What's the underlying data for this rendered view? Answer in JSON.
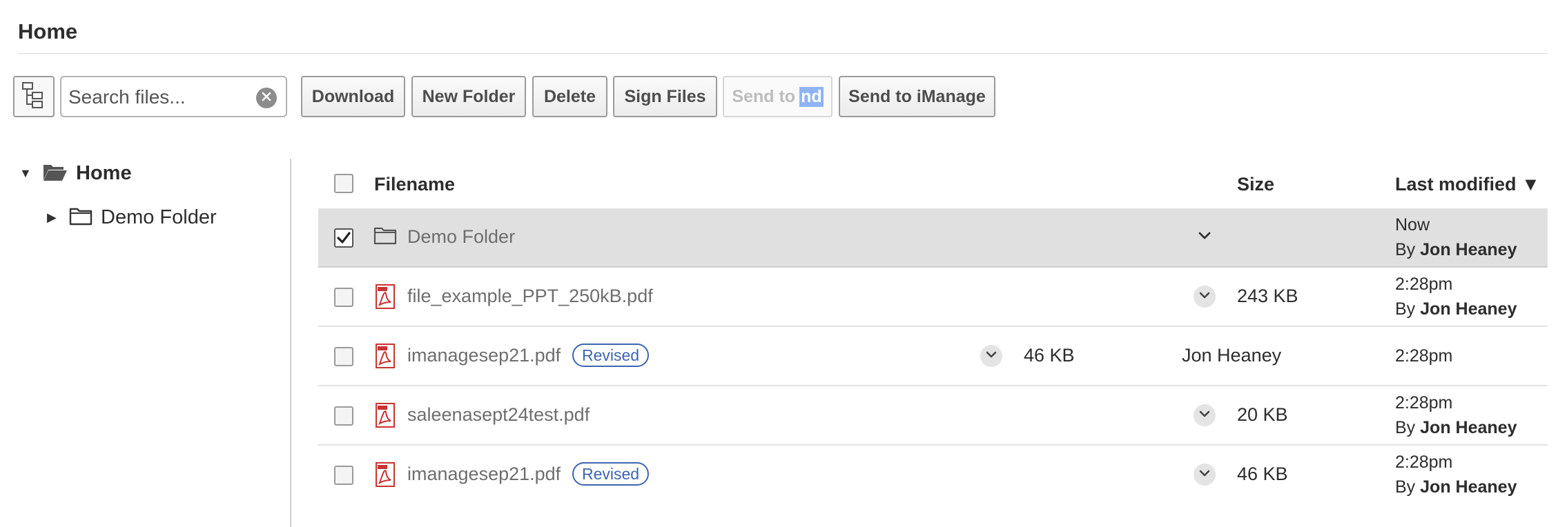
{
  "page": {
    "title": "Home"
  },
  "toolbar": {
    "search_placeholder": "Search files...",
    "download": "Download",
    "new_folder": "New Folder",
    "delete": "Delete",
    "sign_files": "Sign Files",
    "send_to": "Send to",
    "send_to_highlight": "nd",
    "send_to_imanage": "Send to iManage"
  },
  "tree": {
    "root": "Home",
    "children": [
      {
        "label": "Demo Folder"
      }
    ]
  },
  "table": {
    "headers": {
      "filename": "Filename",
      "size": "Size",
      "last_modified": "Last modified ▼"
    },
    "rows": [
      {
        "name": "Demo Folder",
        "type": "folder",
        "selected": true,
        "size": "",
        "modified": "Now",
        "by": "By",
        "author": "Jon Heaney"
      },
      {
        "name": "file_example_PPT_250kB.pdf",
        "type": "pdf",
        "selected": false,
        "size": "243 KB",
        "modified": "2:28pm",
        "by": "By",
        "author": "Jon Heaney"
      },
      {
        "name": "imanagesep21.pdf",
        "type": "pdf",
        "selected": false,
        "badge": "Revised",
        "size": "46 KB",
        "owner": "Jon Heaney",
        "modified": "2:28pm"
      },
      {
        "name": "saleenasept24test.pdf",
        "type": "pdf",
        "selected": false,
        "size": "20 KB",
        "modified": "2:28pm",
        "by": "By",
        "author": "Jon Heaney"
      },
      {
        "name": "imanagesep21.pdf",
        "type": "pdf",
        "selected": false,
        "badge": "Revised",
        "size": "46 KB",
        "modified": "2:28pm",
        "by": "By",
        "author": "Jon Heaney"
      }
    ]
  },
  "colors": {
    "badge": "#3d65b0",
    "pdf_icon": "#c8342f",
    "selected_row": "#e0e0e0",
    "highlight": "#8fb3f3"
  },
  "icons": [
    "tree-view-icon",
    "clear-icon",
    "folder-open-icon",
    "folder-icon",
    "pdf-icon",
    "chevron-down-icon",
    "checkmark-icon"
  ]
}
